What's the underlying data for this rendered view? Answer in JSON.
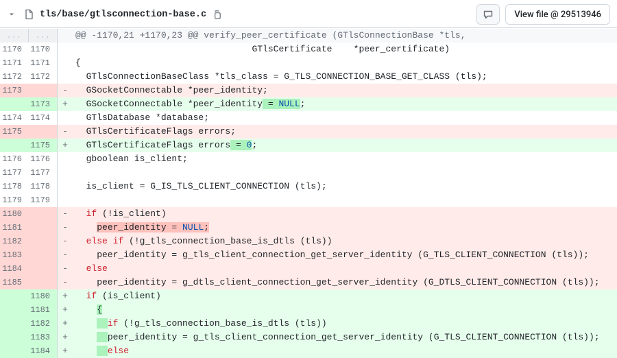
{
  "file": {
    "path": "tls/base/gtlsconnection-base.c",
    "view_button_label": "View file @ 29513946"
  },
  "hunk": {
    "header": "@@ -1170,21 +1170,23 @@ verify_peer_certificate (GTlsConnectionBase *tls,"
  },
  "rows": [
    {
      "type": "hunk",
      "a": "...",
      "b": "...",
      "m": " ",
      "html": "@@ -1170,21 +1170,23 @@ verify_peer_certificate (GTlsConnectionBase *tls,"
    },
    {
      "type": "ctx",
      "a": "1170",
      "b": "1170",
      "m": " ",
      "html": "                                 GTlsCertificate    *peer_certificate)"
    },
    {
      "type": "ctx",
      "a": "1171",
      "b": "1171",
      "m": " ",
      "html": "{"
    },
    {
      "type": "ctx",
      "a": "1172",
      "b": "1172",
      "m": " ",
      "html": "  GTlsConnectionBaseClass *tls_class = G_TLS_CONNECTION_BASE_GET_CLASS (tls);"
    },
    {
      "type": "del",
      "a": "1173",
      "b": "",
      "m": "-",
      "html": "  GSocketConnectable *peer_identity;"
    },
    {
      "type": "add",
      "a": "",
      "b": "1173",
      "m": "+",
      "html": "  GSocketConnectable *peer_identity<span class=\"char-add\"> = <span class=\"k-blue\">NULL</span></span>;"
    },
    {
      "type": "ctx",
      "a": "1174",
      "b": "1174",
      "m": " ",
      "html": "  GTlsDatabase *database;"
    },
    {
      "type": "del",
      "a": "1175",
      "b": "",
      "m": "-",
      "html": "  GTlsCertificateFlags errors;"
    },
    {
      "type": "add",
      "a": "",
      "b": "1175",
      "m": "+",
      "html": "  GTlsCertificateFlags errors<span class=\"char-add\"> = <span class=\"k-blue\">0</span></span>;"
    },
    {
      "type": "ctx",
      "a": "1176",
      "b": "1176",
      "m": " ",
      "html": "  gboolean is_client;"
    },
    {
      "type": "ctx",
      "a": "1177",
      "b": "1177",
      "m": " ",
      "html": ""
    },
    {
      "type": "ctx",
      "a": "1178",
      "b": "1178",
      "m": " ",
      "html": "  is_client = G_IS_TLS_CLIENT_CONNECTION (tls);"
    },
    {
      "type": "ctx",
      "a": "1179",
      "b": "1179",
      "m": " ",
      "html": ""
    },
    {
      "type": "del",
      "a": "1180",
      "b": "",
      "m": "-",
      "html": "  <span class=\"k-red\">if</span> (!is_client)"
    },
    {
      "type": "del",
      "a": "1181",
      "b": "",
      "m": "-",
      "html": "    <span class=\"char-del\">peer_identity = <span class=\"k-blue\">NULL</span>;</span>"
    },
    {
      "type": "del",
      "a": "1182",
      "b": "",
      "m": "-",
      "html": "  <span class=\"k-red\">else</span> <span class=\"k-red\">if</span> (!g_tls_connection_base_is_dtls (tls))"
    },
    {
      "type": "del",
      "a": "1183",
      "b": "",
      "m": "-",
      "html": "    peer_identity = g_tls_client_connection_get_server_identity (G_TLS_CLIENT_CONNECTION (tls));"
    },
    {
      "type": "del",
      "a": "1184",
      "b": "",
      "m": "-",
      "html": "  <span class=\"k-red\">else</span>"
    },
    {
      "type": "del",
      "a": "1185",
      "b": "",
      "m": "-",
      "html": "    peer_identity = g_dtls_client_connection_get_server_identity (G_DTLS_CLIENT_CONNECTION (tls));"
    },
    {
      "type": "add",
      "a": "",
      "b": "1180",
      "m": "+",
      "html": "  <span class=\"k-red\">if</span> (is_client)"
    },
    {
      "type": "add",
      "a": "",
      "b": "1181",
      "m": "+",
      "html": "    <span class=\"char-add\">{</span>"
    },
    {
      "type": "add",
      "a": "",
      "b": "1182",
      "m": "+",
      "html": "    <span class=\"char-add\">  </span><span class=\"k-red\">if</span> (!g_tls_connection_base_is_dtls (tls))"
    },
    {
      "type": "add",
      "a": "",
      "b": "1183",
      "m": "+",
      "html": "    <span class=\"char-add\">  </span>peer_identity = g_tls_client_connection_get_server_identity (G_TLS_CLIENT_CONNECTION (tls));"
    },
    {
      "type": "add",
      "a": "",
      "b": "1184",
      "m": "+",
      "html": "    <span class=\"char-add\">  </span><span class=\"k-red\">else</span>"
    }
  ]
}
